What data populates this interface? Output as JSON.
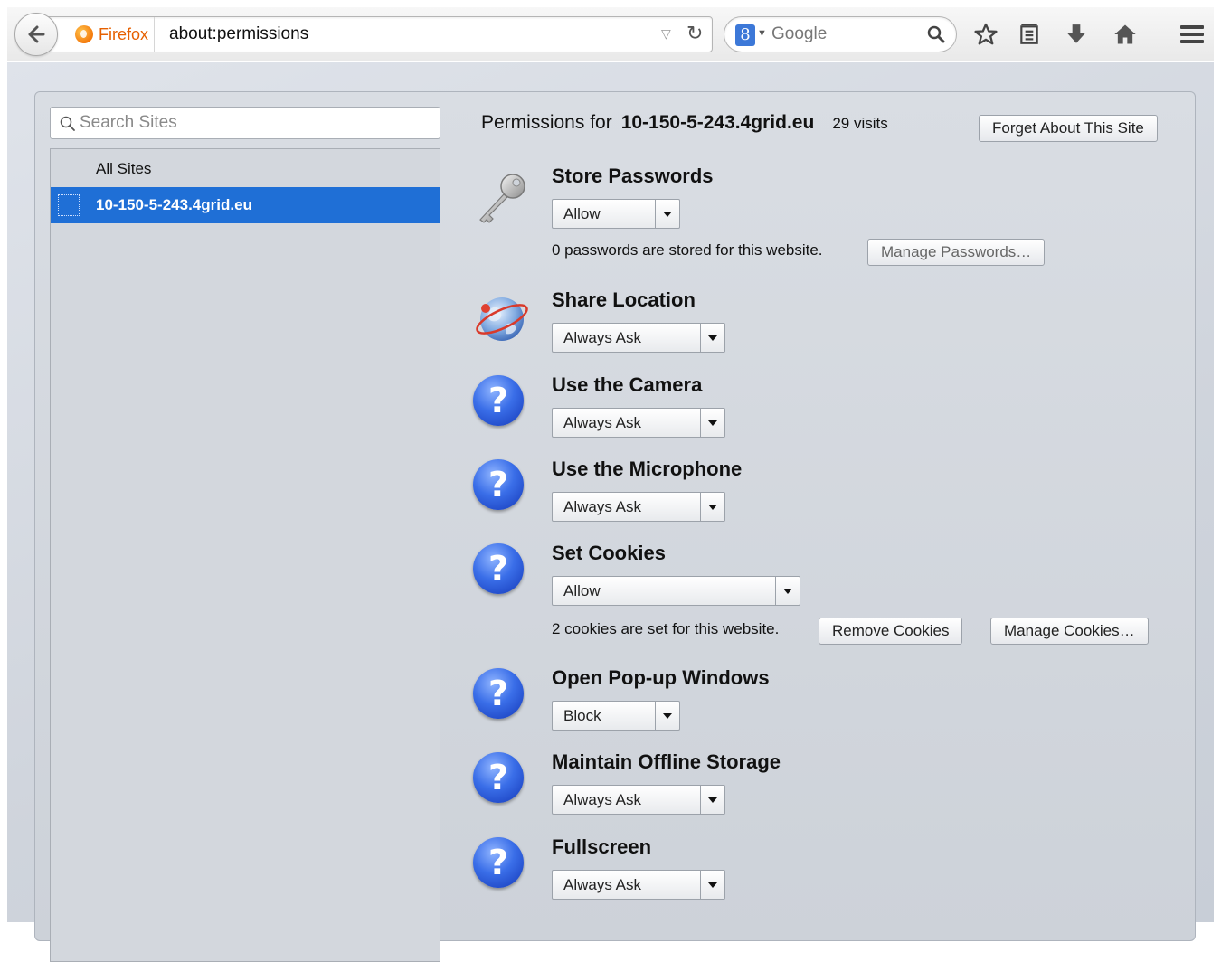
{
  "toolbar": {
    "identity_label": "Firefox",
    "url": "about:permissions",
    "search_engine": "Google",
    "search_engine_icon": "8"
  },
  "sidebar": {
    "search_placeholder": "Search Sites",
    "items": [
      {
        "label": "All Sites",
        "selected": false
      },
      {
        "label": "10-150-5-243.4grid.eu",
        "selected": true
      }
    ]
  },
  "header": {
    "prefix": "Permissions for",
    "site": "10-150-5-243.4grid.eu",
    "visits": "29 visits",
    "forget_button": "Forget About This Site"
  },
  "permissions": [
    {
      "title": "Store Passwords",
      "icon": "key-icon",
      "value": "Allow",
      "note": "0 passwords are stored for this website.",
      "buttons": [
        "Manage Passwords…"
      ]
    },
    {
      "title": "Share Location",
      "icon": "globe-icon",
      "value": "Always Ask"
    },
    {
      "title": "Use the Camera",
      "icon": "question-icon",
      "value": "Always Ask",
      "icon_glyph": "?"
    },
    {
      "title": "Use the Microphone",
      "icon": "question-icon",
      "value": "Always Ask",
      "icon_glyph": "?"
    },
    {
      "title": "Set Cookies",
      "icon": "question-icon",
      "value": "Allow",
      "icon_glyph": "?",
      "note": "2 cookies are set for this website.",
      "buttons": [
        "Remove Cookies",
        "Manage Cookies…"
      ]
    },
    {
      "title": "Open Pop-up Windows",
      "icon": "question-icon",
      "value": "Block",
      "icon_glyph": "?"
    },
    {
      "title": "Maintain Offline Storage",
      "icon": "question-icon",
      "value": "Always Ask",
      "icon_glyph": "?"
    },
    {
      "title": "Fullscreen",
      "icon": "question-icon",
      "value": "Always Ask",
      "icon_glyph": "?"
    }
  ],
  "colors": {
    "selection": "#1f6fd6",
    "identity": "#e66000",
    "page_background": "#d9dde3"
  }
}
